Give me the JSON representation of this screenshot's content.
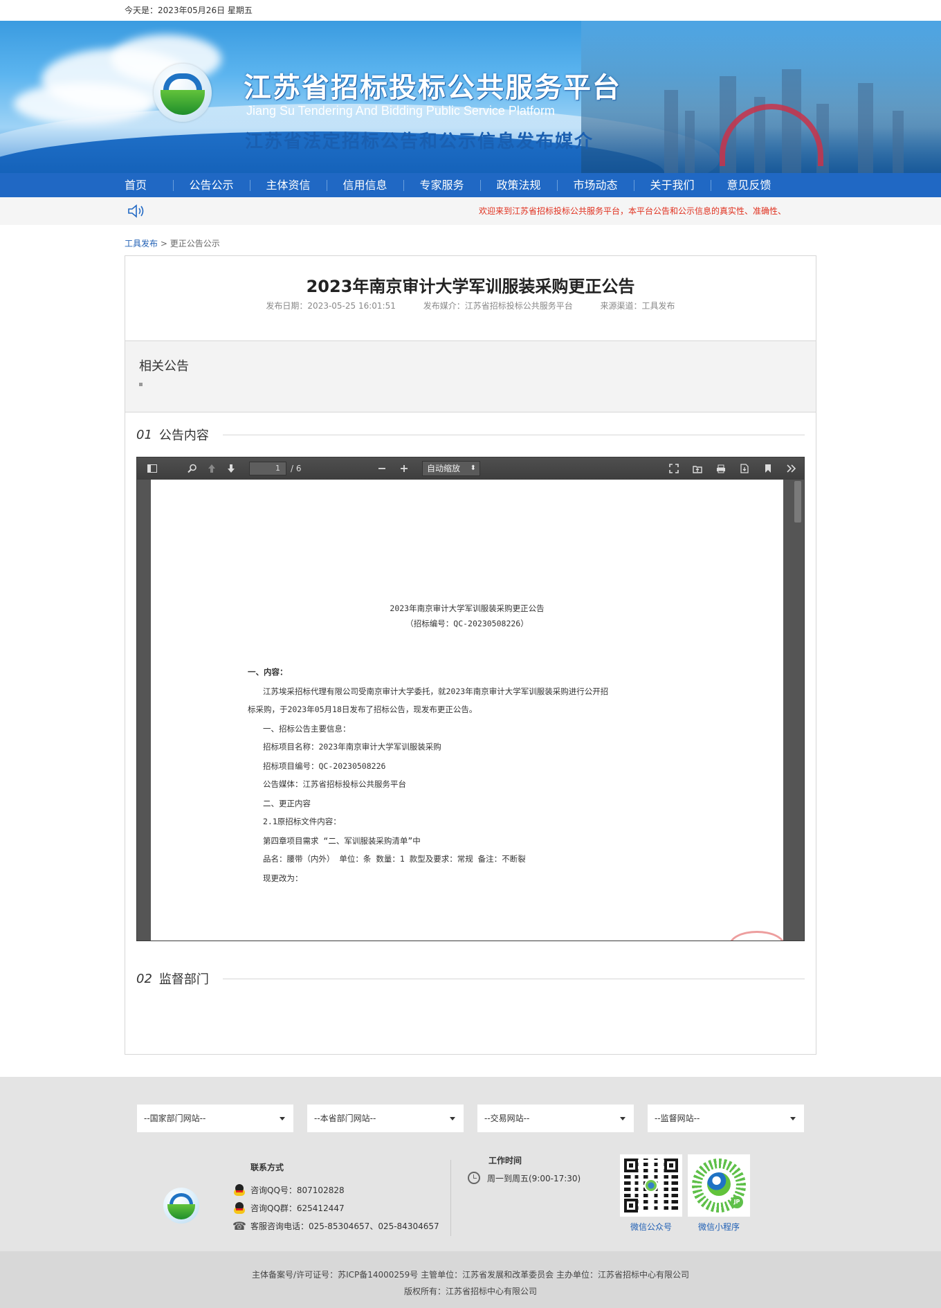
{
  "topbar": {
    "date_text": "今天是：2023年05月26日 星期五"
  },
  "banner": {
    "title_cn": "江苏省招标投标公共服务平台",
    "title_en": "Jiang Su Tendering And Bidding Public Service Platform",
    "slogan": "江苏省法定招标公告和公示信息发布媒介"
  },
  "nav": {
    "items": [
      "首页",
      "公告公示",
      "主体资信",
      "信用信息",
      "专家服务",
      "政策法规",
      "市场动态",
      "关于我们",
      "意见反馈"
    ]
  },
  "notice": {
    "text": "欢迎来到江苏省招标投标公共服务平台，本平台公告和公示信息的真实性、准确性、"
  },
  "breadcrumb": {
    "link": "工具发布",
    "separator": ">",
    "current": "更正公告公示"
  },
  "article": {
    "title": "2023年南京审计大学军训服装采购更正公告",
    "publish_date": "发布日期：2023-05-25 16:01:51",
    "media": "发布媒介：江苏省招标投标公共服务平台",
    "source": "来源渠道：工具发布"
  },
  "related": {
    "heading": "相关公告"
  },
  "sections": [
    {
      "num": "01",
      "label": "公告内容"
    },
    {
      "num": "02",
      "label": "监督部门"
    }
  ],
  "pdf": {
    "page_current": "1",
    "page_total": "/ 6",
    "zoom": "自动缩放",
    "doc_title": "2023年南京审计大学军训服装采购更正公告",
    "doc_sub": "（招标编号：QC-20230508226）",
    "lines": [
      "一、内容：",
      "江苏埃采招标代理有限公司受南京审计大学委托，就2023年南京审计大学军训服装采购进行公开招",
      "标采购，于2023年05月18日发布了招标公告，现发布更正公告。",
      "一、招标公告主要信息：",
      "招标项目名称：2023年南京审计大学军训服装采购",
      "招标项目编号：QC-20230508226",
      "公告媒体：江苏省招标投标公共服务平台",
      "二、更正内容",
      "2.1原招标文件内容：",
      "第四章项目需求 “二、军训服装采购清单”中",
      "品名：腰带（内外） 单位：条 数量：1 款型及要求：常规 备注：不断裂",
      "现更改为："
    ]
  },
  "footer": {
    "selects": [
      "--国家部门网站--",
      "--本省部门网站--",
      "--交易网站--",
      "--监督网站--"
    ],
    "contact_heading": "联系方式",
    "qq": "咨询QQ号：807102828",
    "qq_group": "咨询QQ群：625412447",
    "phone": "客服咨询电话：025-85304657、025-84304657",
    "worktime_heading": "工作时间",
    "worktime": "周一到周五(9:00-17:30)",
    "qr1_label": "微信公众号",
    "qr2_label": "微信小程序",
    "copyright_line1": "主体备案号/许可证号：苏ICP备14000259号 主管单位：江苏省发展和改革委员会 主办单位：江苏省招标中心有限公司",
    "copyright_line2": "版权所有：江苏省招标中心有限公司"
  }
}
